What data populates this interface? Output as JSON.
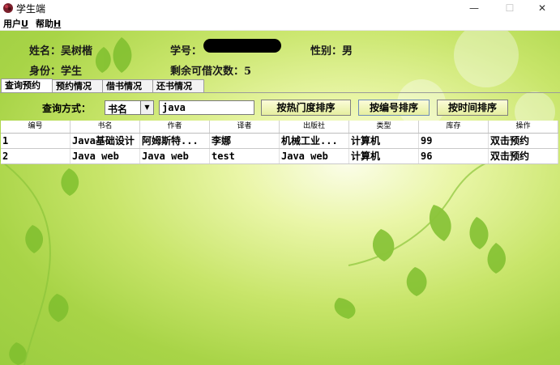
{
  "window": {
    "title": "学生端",
    "icon": "app-icon"
  },
  "menu": [
    {
      "label": "用户",
      "mnemonic": "U"
    },
    {
      "label": "帮助",
      "mnemonic": "H"
    }
  ],
  "info": {
    "name_label": "姓名：吴树楷",
    "student_id_label": "学号：",
    "gender_label": "性别：男",
    "role_label": "身份：学生",
    "remaining_label": "剩余可借次数：5"
  },
  "tabs": [
    "查询预约",
    "预约情况",
    "借书情况",
    "还书情况"
  ],
  "search": {
    "label": "查询方式：",
    "mode": "书名",
    "value": "java",
    "sort_buttons": [
      "按热门度排序",
      "按编号排序",
      "按时间排序"
    ]
  },
  "table": {
    "columns": [
      "编号",
      "书名",
      "作者",
      "译者",
      "出版社",
      "类型",
      "库存",
      "操作"
    ],
    "rows": [
      [
        "1",
        "Java基础设计",
        "阿姆斯特...",
        "李娜",
        "机械工业...",
        "计算机",
        "99",
        "双击预约"
      ],
      [
        "2",
        "Java web",
        "Java web",
        "test",
        "Java web",
        "计算机",
        "96",
        "双击预约"
      ]
    ]
  },
  "colors": {
    "accent": "#a8d447",
    "background_light": "#fbfde8"
  }
}
